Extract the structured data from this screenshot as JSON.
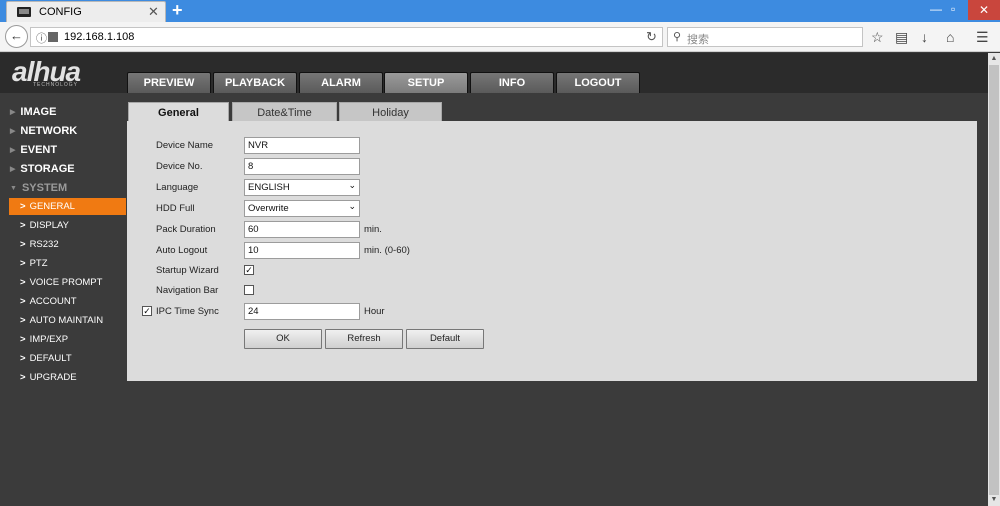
{
  "browser": {
    "tab_title": "CONFIG",
    "tab_close": "✕",
    "new_tab": "+",
    "url": "192.168.1.108",
    "search_placeholder": "搜索",
    "win_min": "—",
    "win_max": "▫",
    "win_close": "✕"
  },
  "app": {
    "logo": "alhua",
    "logo_sub": "TECHNOLOGY",
    "menu": [
      {
        "label": "PREVIEW"
      },
      {
        "label": "PLAYBACK"
      },
      {
        "label": "ALARM"
      },
      {
        "label": "SETUP"
      },
      {
        "label": "INFO"
      },
      {
        "label": "LOGOUT"
      }
    ],
    "active_menu": "SETUP"
  },
  "sidebar": {
    "sections": [
      "IMAGE",
      "NETWORK",
      "EVENT",
      "STORAGE",
      "SYSTEM"
    ],
    "items": [
      {
        "label": "GENERAL"
      },
      {
        "label": "DISPLAY"
      },
      {
        "label": "RS232"
      },
      {
        "label": "PTZ"
      },
      {
        "label": "VOICE PROMPT"
      },
      {
        "label": "ACCOUNT"
      },
      {
        "label": "AUTO MAINTAIN"
      },
      {
        "label": "IMP/EXP"
      },
      {
        "label": "DEFAULT"
      },
      {
        "label": "UPGRADE"
      }
    ],
    "active_item": "GENERAL"
  },
  "subtabs": [
    {
      "label": "General"
    },
    {
      "label": "Date&Time"
    },
    {
      "label": "Holiday"
    }
  ],
  "form": {
    "device_name": {
      "label": "Device Name",
      "value": "NVR"
    },
    "device_no": {
      "label": "Device No.",
      "value": "8"
    },
    "language": {
      "label": "Language",
      "value": "ENGLISH"
    },
    "hdd_full": {
      "label": "HDD Full",
      "value": "Overwrite"
    },
    "pack_duration": {
      "label": "Pack Duration",
      "value": "60",
      "unit": "min."
    },
    "auto_logout": {
      "label": "Auto Logout",
      "value": "10",
      "unit": "min. (0-60)"
    },
    "startup_wizard": {
      "label": "Startup Wizard",
      "checked": true
    },
    "navigation_bar": {
      "label": "Navigation Bar",
      "checked": false
    },
    "ipc_time_sync": {
      "label": "IPC Time Sync",
      "checked": true,
      "value": "24",
      "unit": "Hour"
    }
  },
  "buttons": {
    "ok": "OK",
    "refresh": "Refresh",
    "default": "Default"
  },
  "colors": {
    "accent": "#f07a12",
    "browser_bar": "#3d8be0"
  }
}
